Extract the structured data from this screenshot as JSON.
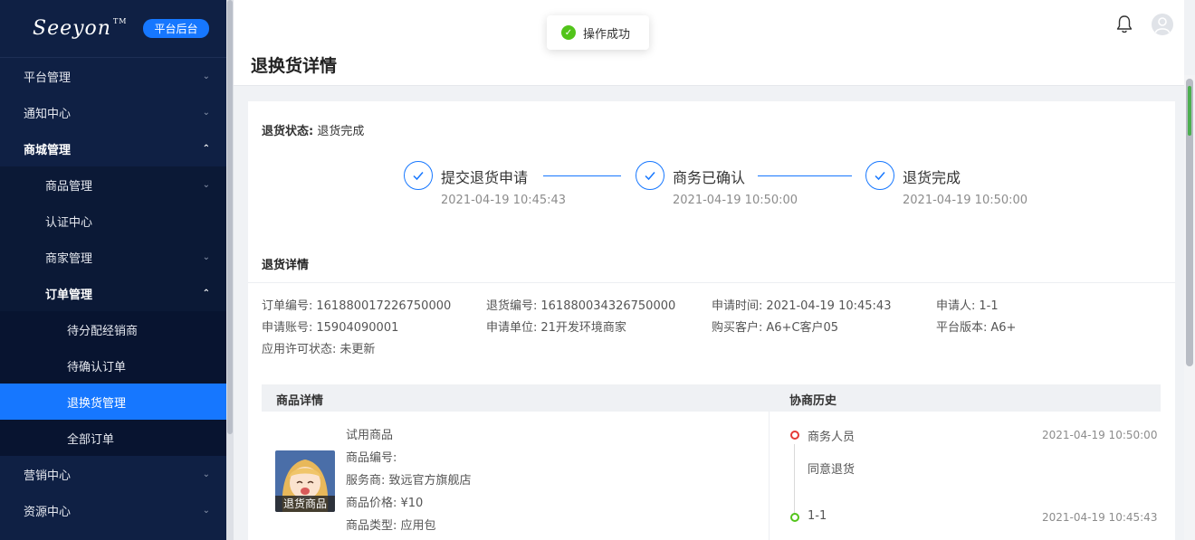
{
  "sidebar": {
    "logo": "Seeyon",
    "logo_mark": "TM",
    "badge": "平台后台",
    "items": [
      {
        "label": "平台管理",
        "level": 1,
        "expanded": false
      },
      {
        "label": "通知中心",
        "level": 1,
        "expanded": false
      },
      {
        "label": "商城管理",
        "level": 1,
        "expanded": true
      },
      {
        "label": "商品管理",
        "level": 2,
        "expanded": false
      },
      {
        "label": "认证中心",
        "level": 2
      },
      {
        "label": "商家管理",
        "level": 2,
        "expanded": false
      },
      {
        "label": "订单管理",
        "level": 2,
        "expanded": true
      },
      {
        "label": "待分配经销商",
        "level": 3
      },
      {
        "label": "待确认订单",
        "level": 3
      },
      {
        "label": "退换货管理",
        "level": 3,
        "active": true
      },
      {
        "label": "全部订单",
        "level": 3
      },
      {
        "label": "营销中心",
        "level": 1,
        "expanded": false
      },
      {
        "label": "资源中心",
        "level": 1,
        "expanded": false
      }
    ]
  },
  "header": {
    "title": "退换货详情"
  },
  "toast": {
    "message": "操作成功"
  },
  "status": {
    "label": "退货状态:",
    "value": "退货完成"
  },
  "steps": [
    {
      "title": "提交退货申请",
      "time": "2021-04-19 10:45:43"
    },
    {
      "title": "商务已确认",
      "time": "2021-04-19 10:50:00"
    },
    {
      "title": "退货完成",
      "time": "2021-04-19 10:50:00"
    }
  ],
  "detail": {
    "title": "退货详情",
    "fields": [
      {
        "label": "订单编号:",
        "value": "161880017226750000"
      },
      {
        "label": "退货编号:",
        "value": "161880034326750000"
      },
      {
        "label": "申请时间:",
        "value": "2021-04-19 10:45:43"
      },
      {
        "label": "申请人:",
        "value": "1-1"
      },
      {
        "label": "申请账号:",
        "value": "15904090001"
      },
      {
        "label": "申请单位:",
        "value": "21开发环境商家"
      },
      {
        "label": "购买客户:",
        "value": "A6+C客户05"
      },
      {
        "label": "平台版本:",
        "value": "A6+"
      },
      {
        "label": "应用许可状态:",
        "value": "未更新"
      }
    ]
  },
  "table": {
    "col_product": "商品详情",
    "col_history": "协商历史"
  },
  "product": {
    "image_label": "退货商品",
    "name": "试用商品",
    "code": "商品编号:",
    "provider": "服务商: 致远官方旗舰店",
    "price": "商品价格: ¥10",
    "type": "商品类型: 应用包"
  },
  "history": [
    {
      "actor": "商务人员",
      "time": "2021-04-19 10:50:00",
      "note": "同意退货",
      "color": "#e53935"
    },
    {
      "actor": "1-1",
      "time": "2021-04-19 10:45:43",
      "note": "",
      "color": "#52c41a"
    }
  ],
  "colors": {
    "sidebar_bg": "#0f2044",
    "accent": "#1677ff",
    "success": "#52c41a"
  }
}
